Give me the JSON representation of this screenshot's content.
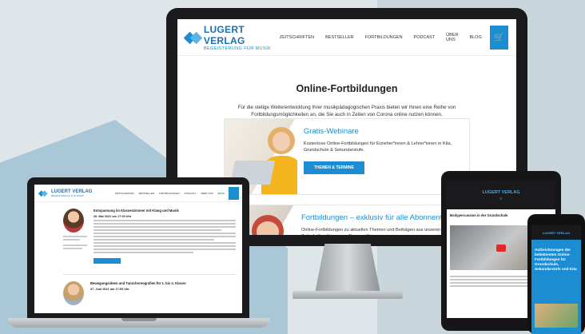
{
  "brand": {
    "name": "LUGERT VERLAG",
    "tagline": "BEGEISTERUNG FÜR MUSIK",
    "accent": "#1c8dd0"
  },
  "desktop": {
    "nav": [
      "ZEITSCHRIFTEN",
      "BESTSELLER",
      "FORTBILDUNGEN",
      "PODCAST",
      "ÜBER UNS",
      "BLOG"
    ],
    "cart_icon": "cart-icon",
    "heading": "Online-Fortbildungen",
    "intro": "Für die stetige Weiterentwicklung Ihrer musikpädagogischen Praxis bieten wir Ihnen eine Reihe von Fortbildungsmöglichkeiten an, die Sie auch in Zeiten von Corona online nutzen können.",
    "cards": [
      {
        "title": "Gratis-Webinare",
        "text": "Kostenlose Online-Fortbildungen für Erzieher*innen & Lehrer*innen in Kita, Grundschule & Sekundarstufe.",
        "button": "THEMEN & TERMINE"
      },
      {
        "title": "Fortbildungen – exklusiv für alle Abonnenten",
        "text": "Online-Fortbildungen zu aktuellen Themen und Beiträgen aus unseren Zeitschriften für unsere Abonnent*innen."
      }
    ]
  },
  "laptop": {
    "nav": [
      "ZEITSCHRIFTEN",
      "BESTSELLER",
      "FORTBILDUNGEN",
      "PODCAST",
      "ÜBER UNS",
      "BLOG"
    ],
    "post1_title": "Entspannung im Klassenzimmer mit Klang und Musik",
    "post1_date": "26. Mai 2021 um 17:00 Uhr",
    "post2_title": "Bewegungsideen und Tanzchoreografien für 1. bis 4. Klasse",
    "post2_date": "07. Juni 2021 um 17:00 Uhr"
  },
  "tablet": {
    "title": "Bodypercussion in der Grundschule"
  },
  "phone": {
    "text": "Aufzeichnungen der beliebtesten Online-Fortbildungen für Grundschule, Sekundarstufe und Kita"
  }
}
